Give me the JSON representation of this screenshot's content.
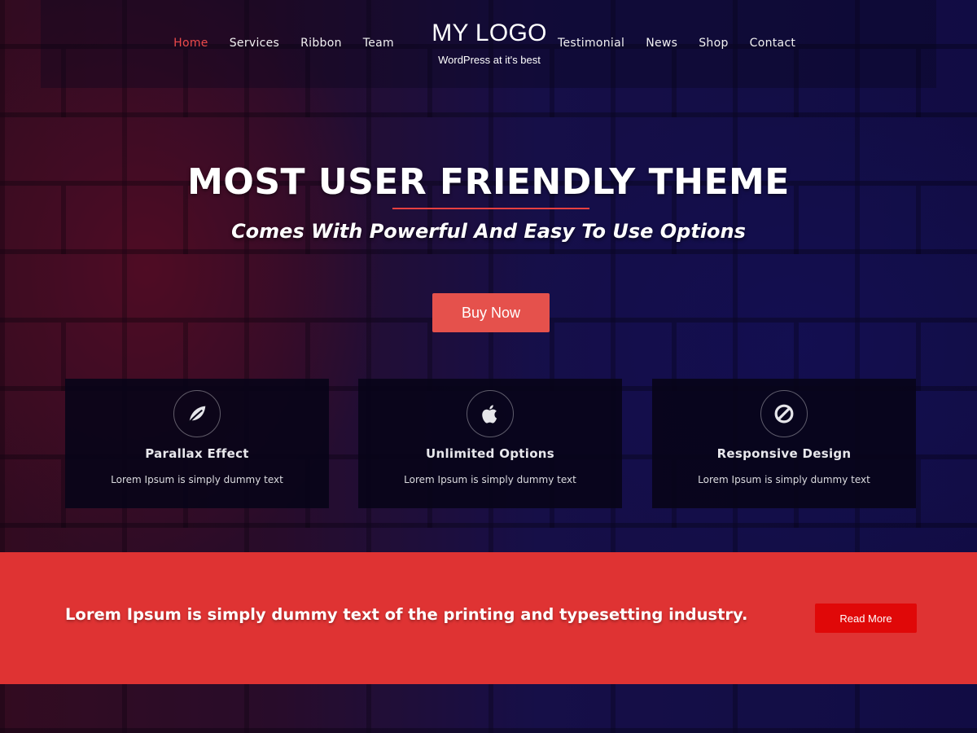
{
  "nav": {
    "left": [
      {
        "label": "Home",
        "active": true
      },
      {
        "label": "Services",
        "active": false
      },
      {
        "label": "Ribbon",
        "active": false
      },
      {
        "label": "Team",
        "active": false
      }
    ],
    "right": [
      {
        "label": "Testimonial",
        "active": false
      },
      {
        "label": "News",
        "active": false
      },
      {
        "label": "Shop",
        "active": false
      },
      {
        "label": "Contact",
        "active": false
      }
    ]
  },
  "logo": {
    "title": "MY LOGO",
    "tagline": "WordPress at it's best"
  },
  "hero": {
    "title": "MOST USER FRIENDLY THEME",
    "subtitle": "Comes With Powerful And Easy To Use Options",
    "button_label": "Buy Now"
  },
  "features": [
    {
      "icon": "leaf-icon",
      "title": "Parallax Effect",
      "text": "Lorem Ipsum is simply dummy text"
    },
    {
      "icon": "apple-icon",
      "title": "Unlimited Options",
      "text": "Lorem Ipsum is simply dummy text"
    },
    {
      "icon": "ban-icon",
      "title": "Responsive Design",
      "text": "Lorem Ipsum is simply dummy text"
    }
  ],
  "ribbon": {
    "text": "Lorem Ipsum is simply dummy text of the printing and typesetting industry.",
    "button_label": "Read More"
  },
  "colors": {
    "accent": "#e5514c",
    "ribbon_bg": "#df3333",
    "read_more_bg": "#e00808",
    "active_nav": "#ec4a4a"
  }
}
